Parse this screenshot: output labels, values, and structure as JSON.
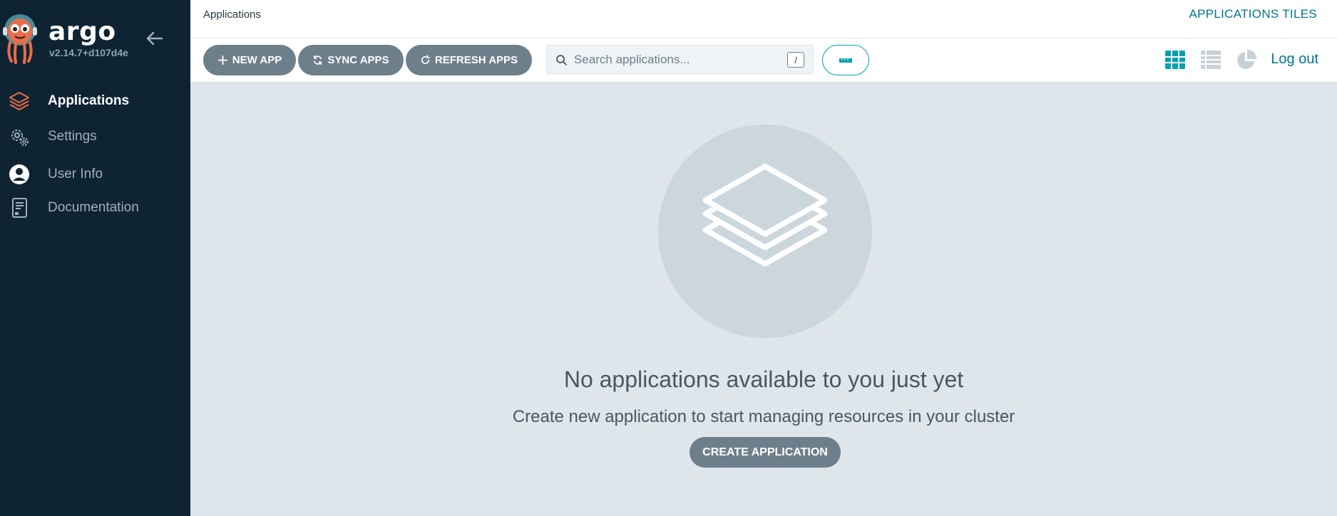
{
  "sidebar": {
    "logo_text": "argo",
    "version": "v2.14.7+d107d4e",
    "collapse_icon": "arrow-left-icon",
    "items": [
      {
        "label": "Applications",
        "icon": "layers-icon",
        "active": true
      },
      {
        "label": "Settings",
        "icon": "gears-icon",
        "active": false
      },
      {
        "label": "User Info",
        "icon": "user-circle-icon",
        "active": false
      },
      {
        "label": "Documentation",
        "icon": "book-icon",
        "active": false
      }
    ]
  },
  "header": {
    "breadcrumb": "Applications",
    "title": "APPLICATIONS TILES"
  },
  "toolbar": {
    "new_app": "NEW APP",
    "sync_apps": "SYNC APPS",
    "refresh_apps": "REFRESH APPS",
    "search_placeholder": "Search applications...",
    "search_shortcut": "/",
    "views": [
      "grid-view-icon",
      "list-view-icon",
      "pie-chart-view-icon"
    ],
    "logout": "Log out"
  },
  "empty_state": {
    "title": "No applications available to you just yet",
    "subtitle": "Create new application to start managing resources in your cluster",
    "button": "CREATE APPLICATION"
  },
  "colors": {
    "sidebar_bg": "#0e2433",
    "accent": "#00a2b3",
    "link": "#00758c",
    "button_bg": "#6d7f8b",
    "main_bg": "#dee6eb",
    "logo_orange": "#e96d4a"
  }
}
